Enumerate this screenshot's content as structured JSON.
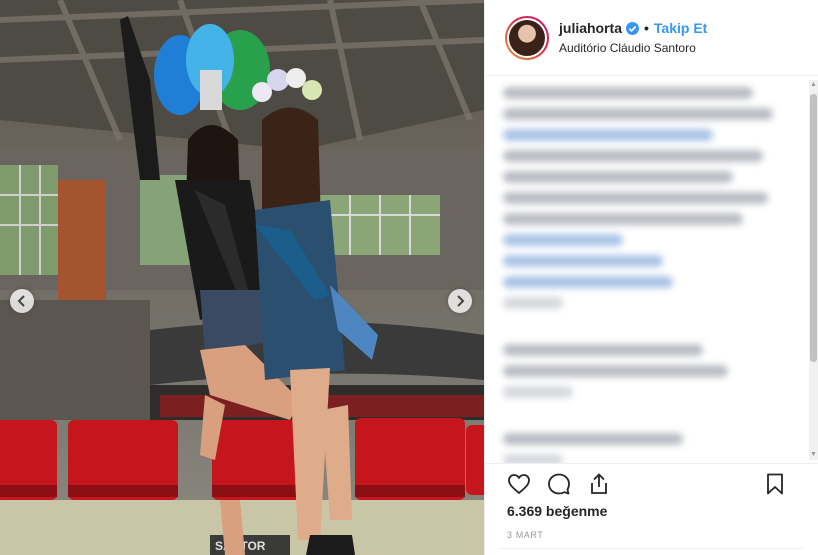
{
  "post": {
    "username": "juliahorta",
    "follow_label": "Takip Et",
    "separator": "•",
    "location": "Auditório Cláudio Santoro",
    "likes": "6.369 beğenme",
    "date": "3 MART",
    "photo_sign": "SANTOR"
  },
  "icons": {
    "verified": "verified-badge-icon",
    "like": "heart-icon",
    "comment": "comment-icon",
    "share": "share-icon",
    "save": "bookmark-icon",
    "prev": "chevron-left-icon",
    "next": "chevron-right-icon"
  },
  "colors": {
    "accent": "#3897f0",
    "text": "#262626",
    "muted": "#999999",
    "border": "#efefef"
  },
  "scrollbar": {
    "up": "▲",
    "down": "▼"
  }
}
